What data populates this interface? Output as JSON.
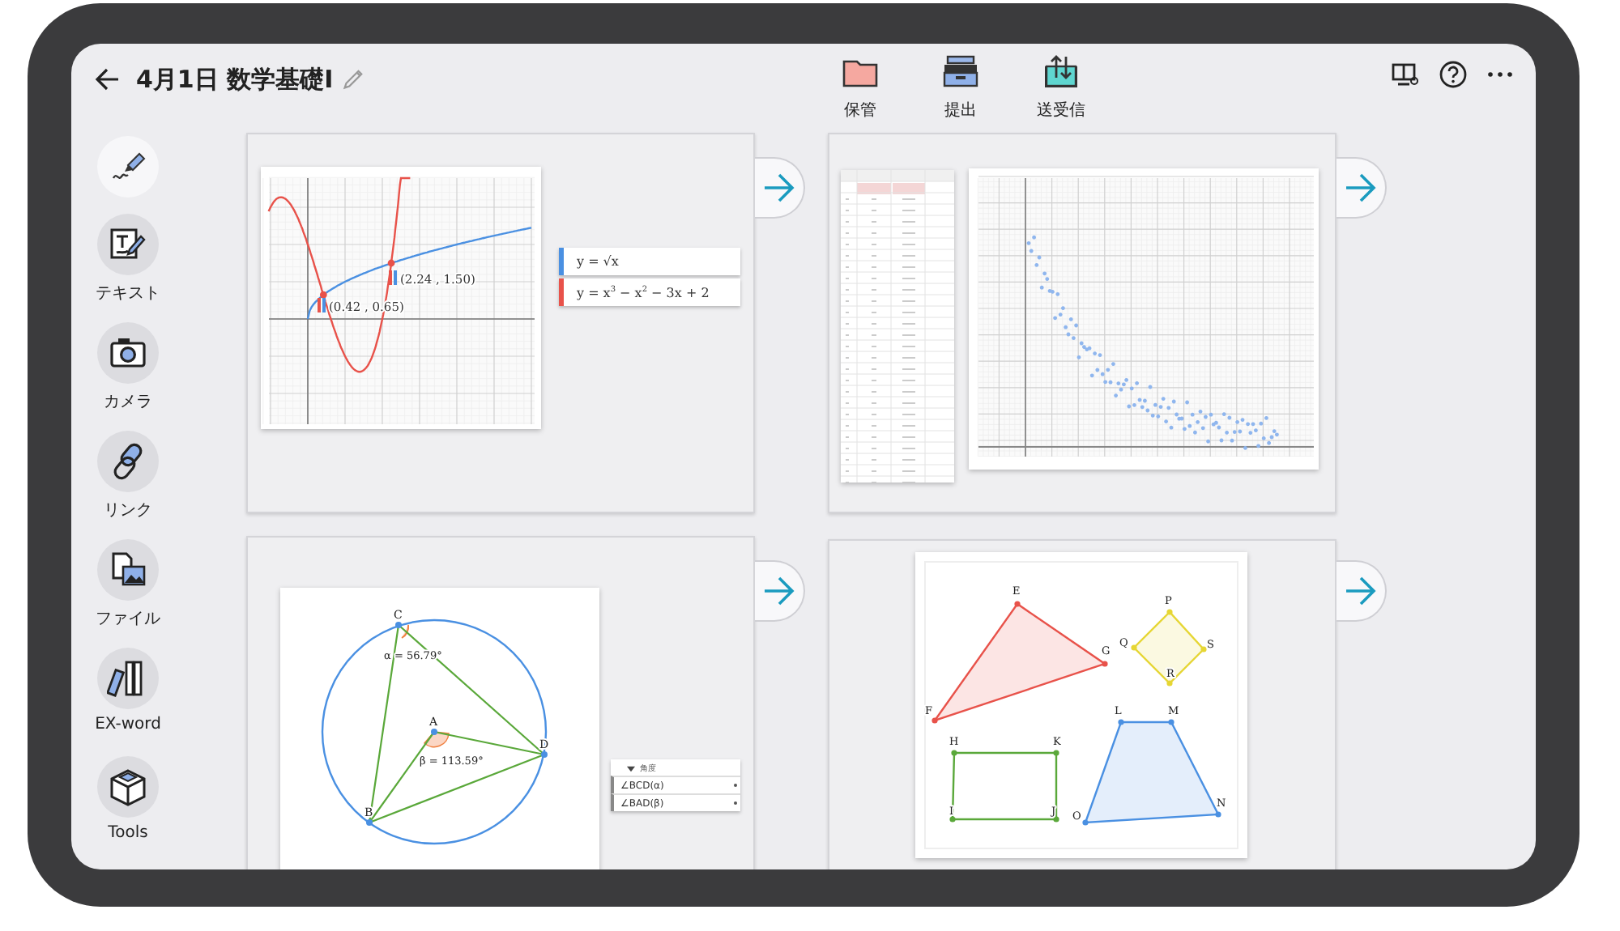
{
  "header": {
    "title": "4月1日 数学基礎I"
  },
  "toolbar": [
    {
      "kind": "folder",
      "label": "保管"
    },
    {
      "kind": "tray",
      "label": "提出"
    },
    {
      "kind": "transfer",
      "label": "送受信"
    }
  ],
  "sidebar": {
    "items": [
      {
        "kind": "pen"
      },
      {
        "kind": "text",
        "label": "テキスト"
      },
      {
        "kind": "camera",
        "label": "カメラ"
      },
      {
        "kind": "link",
        "label": "リンク"
      },
      {
        "kind": "file",
        "label": "ファイル"
      },
      {
        "kind": "dictionary",
        "label": "EX-word"
      },
      {
        "kind": "tools",
        "label": "Tools"
      }
    ]
  },
  "cards": [
    {
      "kind": "graph",
      "points": [
        {
          "label": "(0.42 , 0.65)"
        },
        {
          "label": "(2.24 , 1.50)"
        }
      ],
      "legend": [
        {
          "formula": "y = √x",
          "color": "#4a90e2"
        },
        {
          "formula": "y = x$^{3}$ − x$^{2}$ − 3x + 2",
          "color": "#e8524a"
        }
      ]
    },
    {
      "kind": "scatter"
    },
    {
      "kind": "geometry",
      "labels": [
        "C",
        "A",
        "B",
        "D"
      ],
      "angles": [
        "α = 56.79°",
        "β = 113.59°"
      ],
      "panel": {
        "title": "角度",
        "rows": [
          "∠BCD(α)",
          "∠BAD(β)"
        ]
      }
    },
    {
      "kind": "shapes",
      "shapes": [
        {
          "color": "#e8524a",
          "vertices": [
            "E",
            "F",
            "G"
          ]
        },
        {
          "color": "#e6d634",
          "vertices": [
            "P",
            "Q",
            "R",
            "S"
          ]
        },
        {
          "color": "#5aa83a",
          "vertices": [
            "H",
            "K",
            "I",
            "J"
          ]
        },
        {
          "color": "#4a90e2",
          "vertices": [
            "L",
            "M",
            "N",
            "O"
          ]
        }
      ]
    }
  ]
}
